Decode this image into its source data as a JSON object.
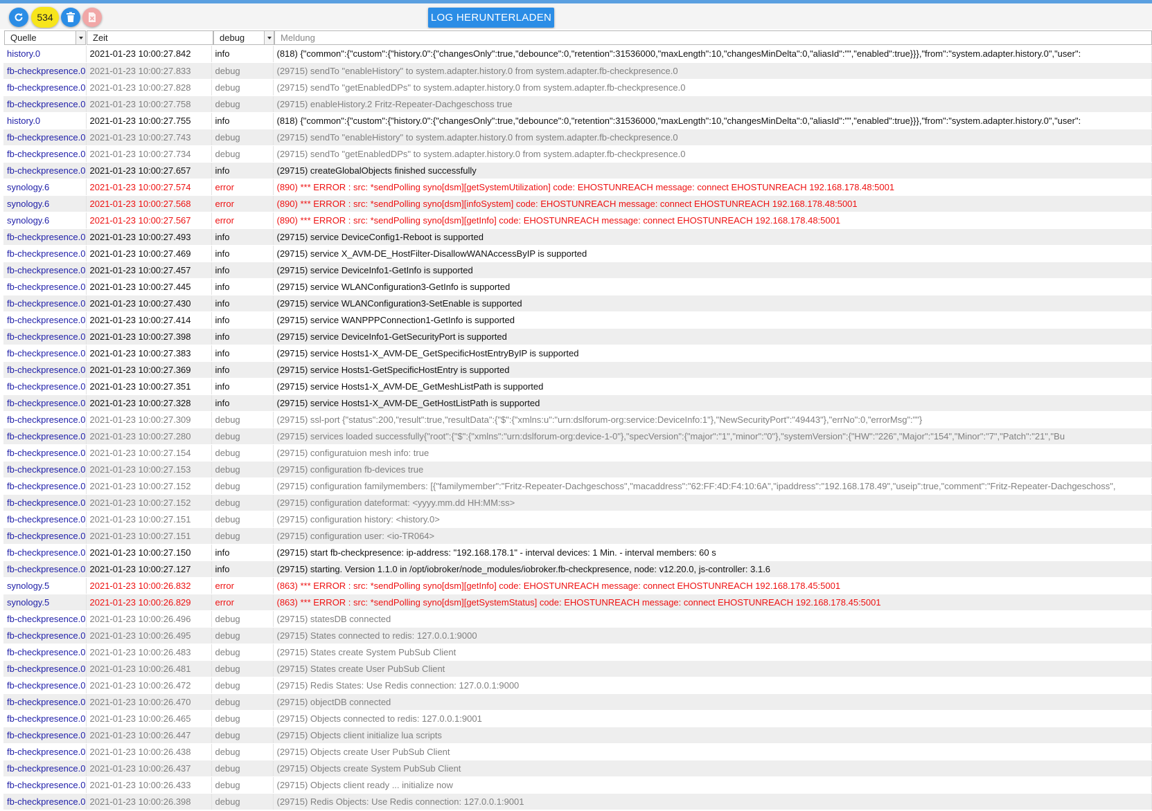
{
  "toolbar": {
    "count_badge": "534",
    "download_label": "LOG HERUNTERLADEN",
    "icons": {
      "refresh": "refresh-icon",
      "delete": "trash-icon",
      "clear": "clear-icon"
    }
  },
  "filters": {
    "source_label": "Quelle",
    "time_label": "Zeit",
    "level_value": "debug",
    "message_placeholder": "Meldung"
  },
  "colors": {
    "accent": "#2b8de6",
    "badge": "#f7e51b",
    "source_text": "#1e1ea8",
    "error_text": "#ee1111",
    "debug_text": "#808080"
  },
  "rows": [
    {
      "src": "history.0",
      "time": "2021-01-23 10:00:27.842",
      "lvl": "info",
      "msg": "(818) {\"common\":{\"custom\":{\"history.0\":{\"changesOnly\":true,\"debounce\":0,\"retention\":31536000,\"maxLength\":10,\"changesMinDelta\":0,\"aliasId\":\"\",\"enabled\":true}}},\"from\":\"system.adapter.history.0\",\"user\":"
    },
    {
      "src": "fb-checkpresence.0",
      "time": "2021-01-23 10:00:27.833",
      "lvl": "debug",
      "msg": "(29715) sendTo \"enableHistory\" to system.adapter.history.0 from system.adapter.fb-checkpresence.0"
    },
    {
      "src": "fb-checkpresence.0",
      "time": "2021-01-23 10:00:27.828",
      "lvl": "debug",
      "msg": "(29715) sendTo \"getEnabledDPs\" to system.adapter.history.0 from system.adapter.fb-checkpresence.0"
    },
    {
      "src": "fb-checkpresence.0",
      "time": "2021-01-23 10:00:27.758",
      "lvl": "debug",
      "msg": "(29715) enableHistory.2 Fritz-Repeater-Dachgeschoss true"
    },
    {
      "src": "history.0",
      "time": "2021-01-23 10:00:27.755",
      "lvl": "info",
      "msg": "(818) {\"common\":{\"custom\":{\"history.0\":{\"changesOnly\":true,\"debounce\":0,\"retention\":31536000,\"maxLength\":10,\"changesMinDelta\":0,\"aliasId\":\"\",\"enabled\":true}}},\"from\":\"system.adapter.history.0\",\"user\":"
    },
    {
      "src": "fb-checkpresence.0",
      "time": "2021-01-23 10:00:27.743",
      "lvl": "debug",
      "msg": "(29715) sendTo \"enableHistory\" to system.adapter.history.0 from system.adapter.fb-checkpresence.0"
    },
    {
      "src": "fb-checkpresence.0",
      "time": "2021-01-23 10:00:27.734",
      "lvl": "debug",
      "msg": "(29715) sendTo \"getEnabledDPs\" to system.adapter.history.0 from system.adapter.fb-checkpresence.0"
    },
    {
      "src": "fb-checkpresence.0",
      "time": "2021-01-23 10:00:27.657",
      "lvl": "info",
      "msg": "(29715) createGlobalObjects finished successfully"
    },
    {
      "src": "synology.6",
      "time": "2021-01-23 10:00:27.574",
      "lvl": "error",
      "msg": "(890) *** ERROR : src: *sendPolling syno[dsm][getSystemUtilization] code: EHOSTUNREACH message: connect EHOSTUNREACH 192.168.178.48:5001"
    },
    {
      "src": "synology.6",
      "time": "2021-01-23 10:00:27.568",
      "lvl": "error",
      "msg": "(890) *** ERROR : src: *sendPolling syno[dsm][infoSystem] code: EHOSTUNREACH message: connect EHOSTUNREACH 192.168.178.48:5001"
    },
    {
      "src": "synology.6",
      "time": "2021-01-23 10:00:27.567",
      "lvl": "error",
      "msg": "(890) *** ERROR : src: *sendPolling syno[dsm][getInfo] code: EHOSTUNREACH message: connect EHOSTUNREACH 192.168.178.48:5001"
    },
    {
      "src": "fb-checkpresence.0",
      "time": "2021-01-23 10:00:27.493",
      "lvl": "info",
      "msg": "(29715) service DeviceConfig1-Reboot is supported"
    },
    {
      "src": "fb-checkpresence.0",
      "time": "2021-01-23 10:00:27.469",
      "lvl": "info",
      "msg": "(29715) service X_AVM-DE_HostFilter-DisallowWANAccessByIP is supported"
    },
    {
      "src": "fb-checkpresence.0",
      "time": "2021-01-23 10:00:27.457",
      "lvl": "info",
      "msg": "(29715) service DeviceInfo1-GetInfo is supported"
    },
    {
      "src": "fb-checkpresence.0",
      "time": "2021-01-23 10:00:27.445",
      "lvl": "info",
      "msg": "(29715) service WLANConfiguration3-GetInfo is supported"
    },
    {
      "src": "fb-checkpresence.0",
      "time": "2021-01-23 10:00:27.430",
      "lvl": "info",
      "msg": "(29715) service WLANConfiguration3-SetEnable is supported"
    },
    {
      "src": "fb-checkpresence.0",
      "time": "2021-01-23 10:00:27.414",
      "lvl": "info",
      "msg": "(29715) service WANPPPConnection1-GetInfo is supported"
    },
    {
      "src": "fb-checkpresence.0",
      "time": "2021-01-23 10:00:27.398",
      "lvl": "info",
      "msg": "(29715) service DeviceInfo1-GetSecurityPort is supported"
    },
    {
      "src": "fb-checkpresence.0",
      "time": "2021-01-23 10:00:27.383",
      "lvl": "info",
      "msg": "(29715) service Hosts1-X_AVM-DE_GetSpecificHostEntryByIP is supported"
    },
    {
      "src": "fb-checkpresence.0",
      "time": "2021-01-23 10:00:27.369",
      "lvl": "info",
      "msg": "(29715) service Hosts1-GetSpecificHostEntry is supported"
    },
    {
      "src": "fb-checkpresence.0",
      "time": "2021-01-23 10:00:27.351",
      "lvl": "info",
      "msg": "(29715) service Hosts1-X_AVM-DE_GetMeshListPath is supported"
    },
    {
      "src": "fb-checkpresence.0",
      "time": "2021-01-23 10:00:27.328",
      "lvl": "info",
      "msg": "(29715) service Hosts1-X_AVM-DE_GetHostListPath is supported"
    },
    {
      "src": "fb-checkpresence.0",
      "time": "2021-01-23 10:00:27.309",
      "lvl": "debug",
      "msg": "(29715) ssl-port {\"status\":200,\"result\":true,\"resultData\":{\"$\":{\"xmlns:u\":\"urn:dslforum-org:service:DeviceInfo:1\"},\"NewSecurityPort\":\"49443\"},\"errNo\":0,\"errorMsg\":\"\"}"
    },
    {
      "src": "fb-checkpresence.0",
      "time": "2021-01-23 10:00:27.280",
      "lvl": "debug",
      "msg": "(29715) services loaded successfully{\"root\":{\"$\":{\"xmlns\":\"urn:dslforum-org:device-1-0\"},\"specVersion\":{\"major\":\"1\",\"minor\":\"0\"},\"systemVersion\":{\"HW\":\"226\",\"Major\":\"154\",\"Minor\":\"7\",\"Patch\":\"21\",\"Bu"
    },
    {
      "src": "fb-checkpresence.0",
      "time": "2021-01-23 10:00:27.154",
      "lvl": "debug",
      "msg": "(29715) configuratuion mesh info: true"
    },
    {
      "src": "fb-checkpresence.0",
      "time": "2021-01-23 10:00:27.153",
      "lvl": "debug",
      "msg": "(29715) configuration fb-devices true"
    },
    {
      "src": "fb-checkpresence.0",
      "time": "2021-01-23 10:00:27.152",
      "lvl": "debug",
      "msg": "(29715) configuration familymembers: [{\"familymember\":\"Fritz-Repeater-Dachgeschoss\",\"macaddress\":\"62:FF:4D:F4:10:6A\",\"ipaddress\":\"192.168.178.49\",\"useip\":true,\"comment\":\"Fritz-Repeater-Dachgeschoss\","
    },
    {
      "src": "fb-checkpresence.0",
      "time": "2021-01-23 10:00:27.152",
      "lvl": "debug",
      "msg": "(29715) configuration dateformat: <yyyy.mm.dd HH:MM:ss>"
    },
    {
      "src": "fb-checkpresence.0",
      "time": "2021-01-23 10:00:27.151",
      "lvl": "debug",
      "msg": "(29715) configuration history: <history.0>"
    },
    {
      "src": "fb-checkpresence.0",
      "time": "2021-01-23 10:00:27.151",
      "lvl": "debug",
      "msg": "(29715) configuration user: <io-TR064>"
    },
    {
      "src": "fb-checkpresence.0",
      "time": "2021-01-23 10:00:27.150",
      "lvl": "info",
      "msg": "(29715) start fb-checkpresence: ip-address: \"192.168.178.1\" - interval devices: 1 Min. - interval members: 60 s"
    },
    {
      "src": "fb-checkpresence.0",
      "time": "2021-01-23 10:00:27.127",
      "lvl": "info",
      "msg": "(29715) starting. Version 1.1.0 in /opt/iobroker/node_modules/iobroker.fb-checkpresence, node: v12.20.0, js-controller: 3.1.6"
    },
    {
      "src": "synology.5",
      "time": "2021-01-23 10:00:26.832",
      "lvl": "error",
      "msg": "(863) *** ERROR : src: *sendPolling syno[dsm][getInfo] code: EHOSTUNREACH message: connect EHOSTUNREACH 192.168.178.45:5001"
    },
    {
      "src": "synology.5",
      "time": "2021-01-23 10:00:26.829",
      "lvl": "error",
      "msg": "(863) *** ERROR : src: *sendPolling syno[dsm][getSystemStatus] code: EHOSTUNREACH message: connect EHOSTUNREACH 192.168.178.45:5001"
    },
    {
      "src": "fb-checkpresence.0",
      "time": "2021-01-23 10:00:26.496",
      "lvl": "debug",
      "msg": "(29715) statesDB connected"
    },
    {
      "src": "fb-checkpresence.0",
      "time": "2021-01-23 10:00:26.495",
      "lvl": "debug",
      "msg": "(29715) States connected to redis: 127.0.0.1:9000"
    },
    {
      "src": "fb-checkpresence.0",
      "time": "2021-01-23 10:00:26.483",
      "lvl": "debug",
      "msg": "(29715) States create System PubSub Client"
    },
    {
      "src": "fb-checkpresence.0",
      "time": "2021-01-23 10:00:26.481",
      "lvl": "debug",
      "msg": "(29715) States create User PubSub Client"
    },
    {
      "src": "fb-checkpresence.0",
      "time": "2021-01-23 10:00:26.472",
      "lvl": "debug",
      "msg": "(29715) Redis States: Use Redis connection: 127.0.0.1:9000"
    },
    {
      "src": "fb-checkpresence.0",
      "time": "2021-01-23 10:00:26.470",
      "lvl": "debug",
      "msg": "(29715) objectDB connected"
    },
    {
      "src": "fb-checkpresence.0",
      "time": "2021-01-23 10:00:26.465",
      "lvl": "debug",
      "msg": "(29715) Objects connected to redis: 127.0.0.1:9001"
    },
    {
      "src": "fb-checkpresence.0",
      "time": "2021-01-23 10:00:26.447",
      "lvl": "debug",
      "msg": "(29715) Objects client initialize lua scripts"
    },
    {
      "src": "fb-checkpresence.0",
      "time": "2021-01-23 10:00:26.438",
      "lvl": "debug",
      "msg": "(29715) Objects create User PubSub Client"
    },
    {
      "src": "fb-checkpresence.0",
      "time": "2021-01-23 10:00:26.437",
      "lvl": "debug",
      "msg": "(29715) Objects create System PubSub Client"
    },
    {
      "src": "fb-checkpresence.0",
      "time": "2021-01-23 10:00:26.433",
      "lvl": "debug",
      "msg": "(29715) Objects client ready ... initialize now"
    },
    {
      "src": "fb-checkpresence.0",
      "time": "2021-01-23 10:00:26.398",
      "lvl": "debug",
      "msg": "(29715) Redis Objects: Use Redis connection: 127.0.0.1:9001"
    }
  ]
}
